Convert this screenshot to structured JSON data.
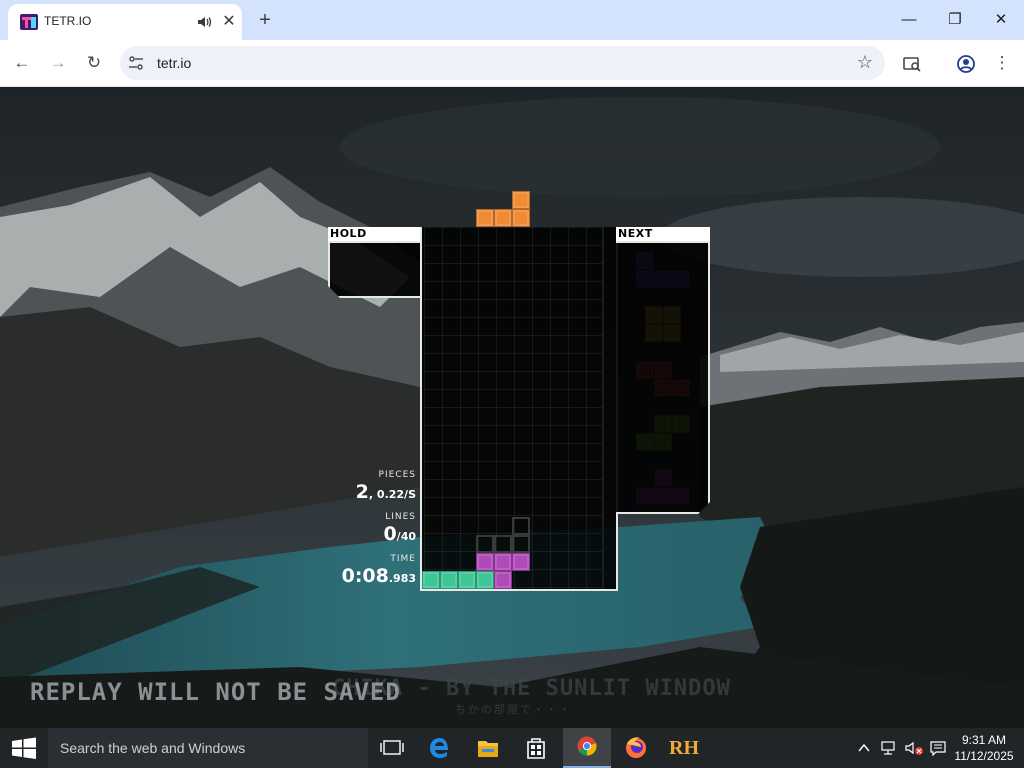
{
  "browser": {
    "tab_title": "TETR.IO",
    "tab_close_glyph": "✕",
    "new_tab_glyph": "+",
    "url": "tetr.io",
    "window_controls": {
      "minimize": "—",
      "maximize": "❐",
      "close": "✕"
    },
    "nav": {
      "back": "←",
      "forward": "→",
      "reload": "↻"
    },
    "star_glyph": "☆",
    "menu_glyph": "⋮"
  },
  "game": {
    "hold_label": "HOLD",
    "next_label": "NEXT",
    "stats": {
      "pieces_label": "PIECES",
      "pieces_value": "2",
      "pieces_rate": ", 0.22/S",
      "lines_label": "LINES",
      "lines_value": "0",
      "lines_goal": "/40",
      "time_label": "TIME",
      "time_main": "0:08",
      "time_ms": ".983"
    },
    "replay_notice": "REPLAY WILL NOT BE SAVED",
    "song_title": "CHIKA - BY THE SUNLIT WINDOW",
    "song_subtitle": "ちかの部屋で・・・",
    "piece_colors": {
      "L": "#f08a33",
      "J": "#6a4fd1",
      "O": "#c6a838",
      "Z": "#d3424a",
      "S": "#8cc43c",
      "T": "#b04ab8",
      "I": "#3ec697",
      "ghost": "#3a3a3a"
    }
  },
  "taskbar": {
    "search_placeholder": "Search the web and Windows",
    "time": "9:31 AM",
    "date": "11/12/2025",
    "apps": [
      "task-view",
      "edge",
      "file-explorer",
      "store",
      "chrome",
      "firefox",
      "rh"
    ],
    "rh_label": "RH"
  }
}
